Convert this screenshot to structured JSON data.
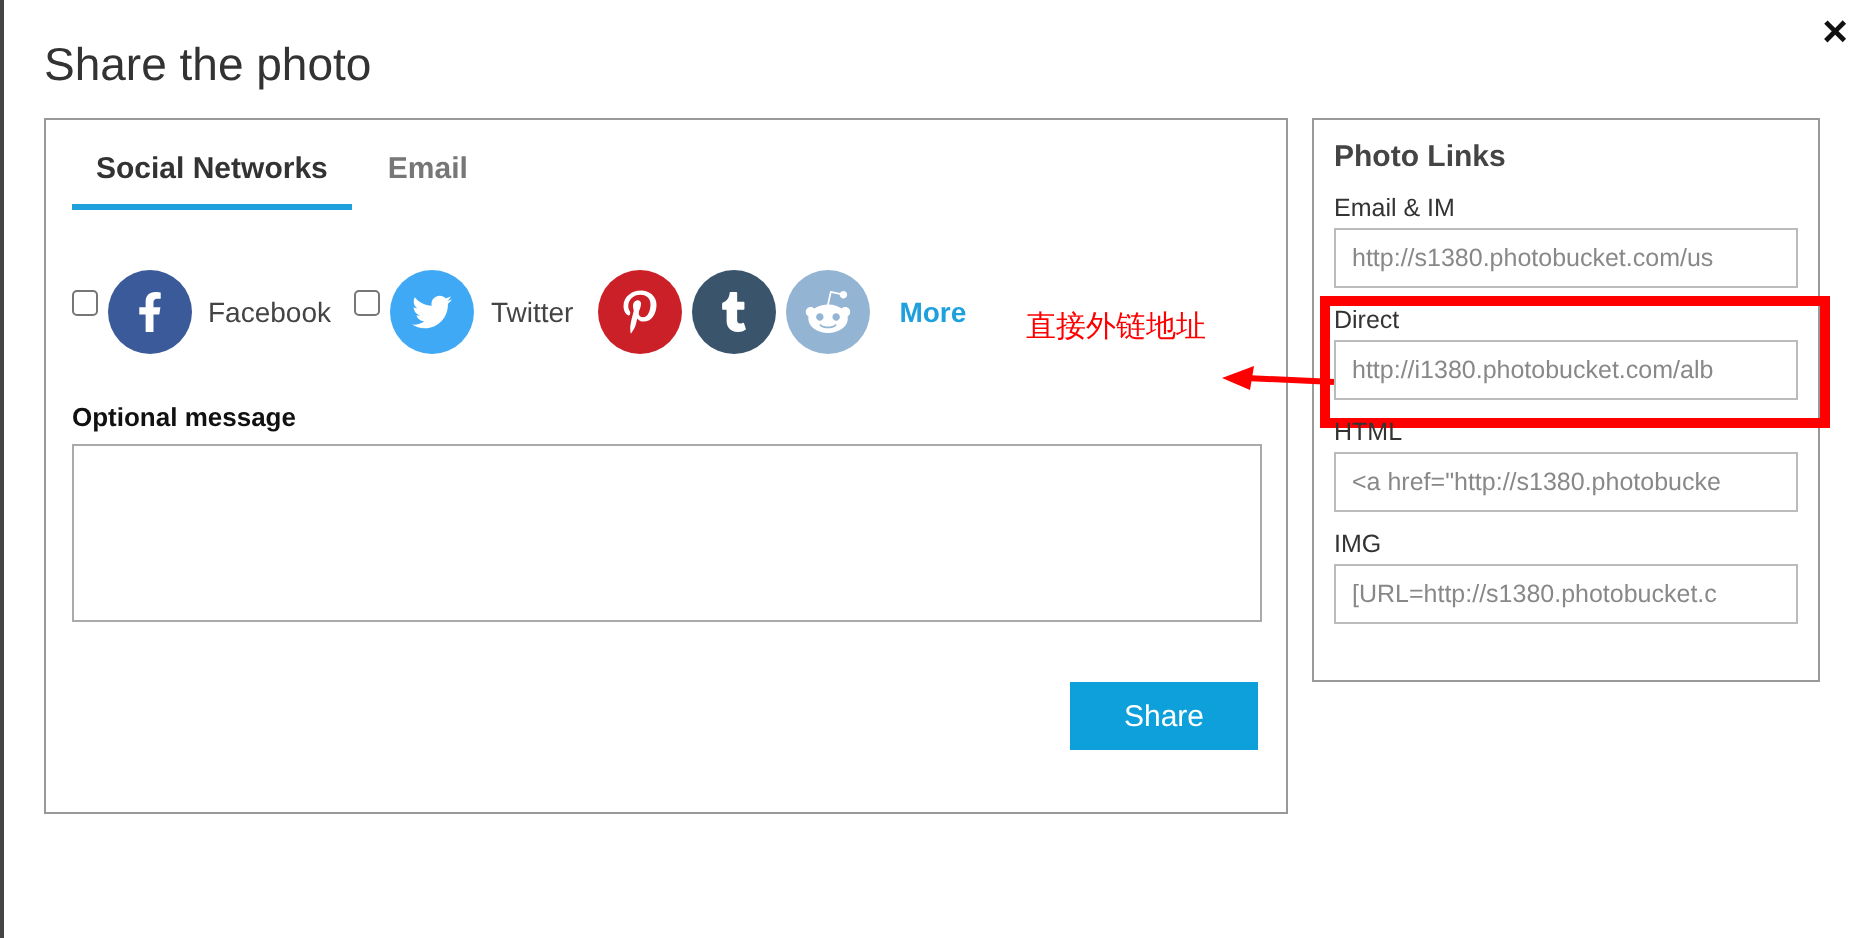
{
  "dialog": {
    "title": "Share the photo",
    "close": "×"
  },
  "tabs": [
    {
      "label": "Social Networks",
      "selected": true
    },
    {
      "label": "Email",
      "selected": false
    }
  ],
  "networks": [
    {
      "kind": "checkbox",
      "label": "Facebook",
      "checked": false,
      "color": "#3b5a9a"
    },
    {
      "kind": "checkbox",
      "label": "Twitter",
      "checked": false,
      "color": "#3fa9f5"
    },
    {
      "kind": "icon",
      "color": "#cb2027"
    },
    {
      "kind": "icon",
      "color": "#3a546c"
    },
    {
      "kind": "icon",
      "color": "#94b4d4"
    }
  ],
  "more_link": "More",
  "message": {
    "label": "Optional message"
  },
  "share_button": "Share",
  "photo_links": {
    "title": "Photo Links",
    "fields": [
      {
        "label": "Email & IM",
        "value": "http://s1380.photobucket.com/us",
        "highlighted": false
      },
      {
        "label": "Direct",
        "value": "http://i1380.photobucket.com/alb",
        "highlighted": true
      },
      {
        "label": "HTML",
        "value": "<a href=\"http://s1380.photobucke",
        "highlighted": false
      },
      {
        "label": "IMG",
        "value": "[URL=http://s1380.photobucket.c",
        "highlighted": false
      }
    ]
  },
  "annotation": {
    "text": "直接外链地址"
  }
}
